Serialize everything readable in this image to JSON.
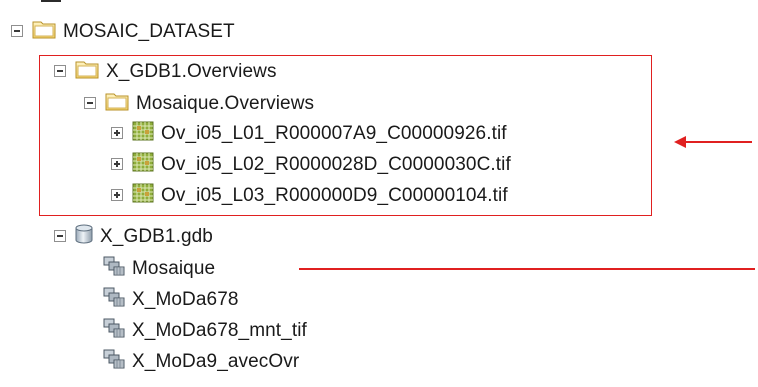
{
  "tree": {
    "root": {
      "label": "MOSAIC_DATASET",
      "icon": "folder-icon",
      "state": "expanded"
    },
    "gdb1_overviews": {
      "label": "X_GDB1.Overviews",
      "icon": "folder-icon",
      "state": "expanded"
    },
    "mosaique_overviews": {
      "label": "Mosaique.Overviews",
      "icon": "folder-icon",
      "state": "expanded"
    },
    "raster_files": [
      {
        "label": "Ov_i05_L01_R000007A9_C00000926.tif",
        "icon": "raster-dataset-icon",
        "state": "collapsed"
      },
      {
        "label": "Ov_i05_L02_R0000028D_C0000030C.tif",
        "icon": "raster-dataset-icon",
        "state": "collapsed"
      },
      {
        "label": "Ov_i05_L03_R000000D9_C00000104.tif",
        "icon": "raster-dataset-icon",
        "state": "collapsed"
      }
    ],
    "gdb": {
      "label": "X_GDB1.gdb",
      "icon": "database-icon",
      "state": "expanded"
    },
    "mosaic_datasets": [
      {
        "label": "Mosaique",
        "icon": "mosaic-dataset-icon"
      },
      {
        "label": "X_MoDa678",
        "icon": "mosaic-dataset-icon"
      },
      {
        "label": "X_MoDa678_mnt_tif",
        "icon": "mosaic-dataset-icon"
      },
      {
        "label": "X_MoDa9_avecOvr",
        "icon": "mosaic-dataset-icon"
      }
    ]
  },
  "annotations": {
    "highlight_color": "#e02020",
    "highlight_box": "overview-files",
    "arrow_target": "Ov_i05_L01_R000007A9_C00000926.tif",
    "line_target": "Mosaique"
  }
}
